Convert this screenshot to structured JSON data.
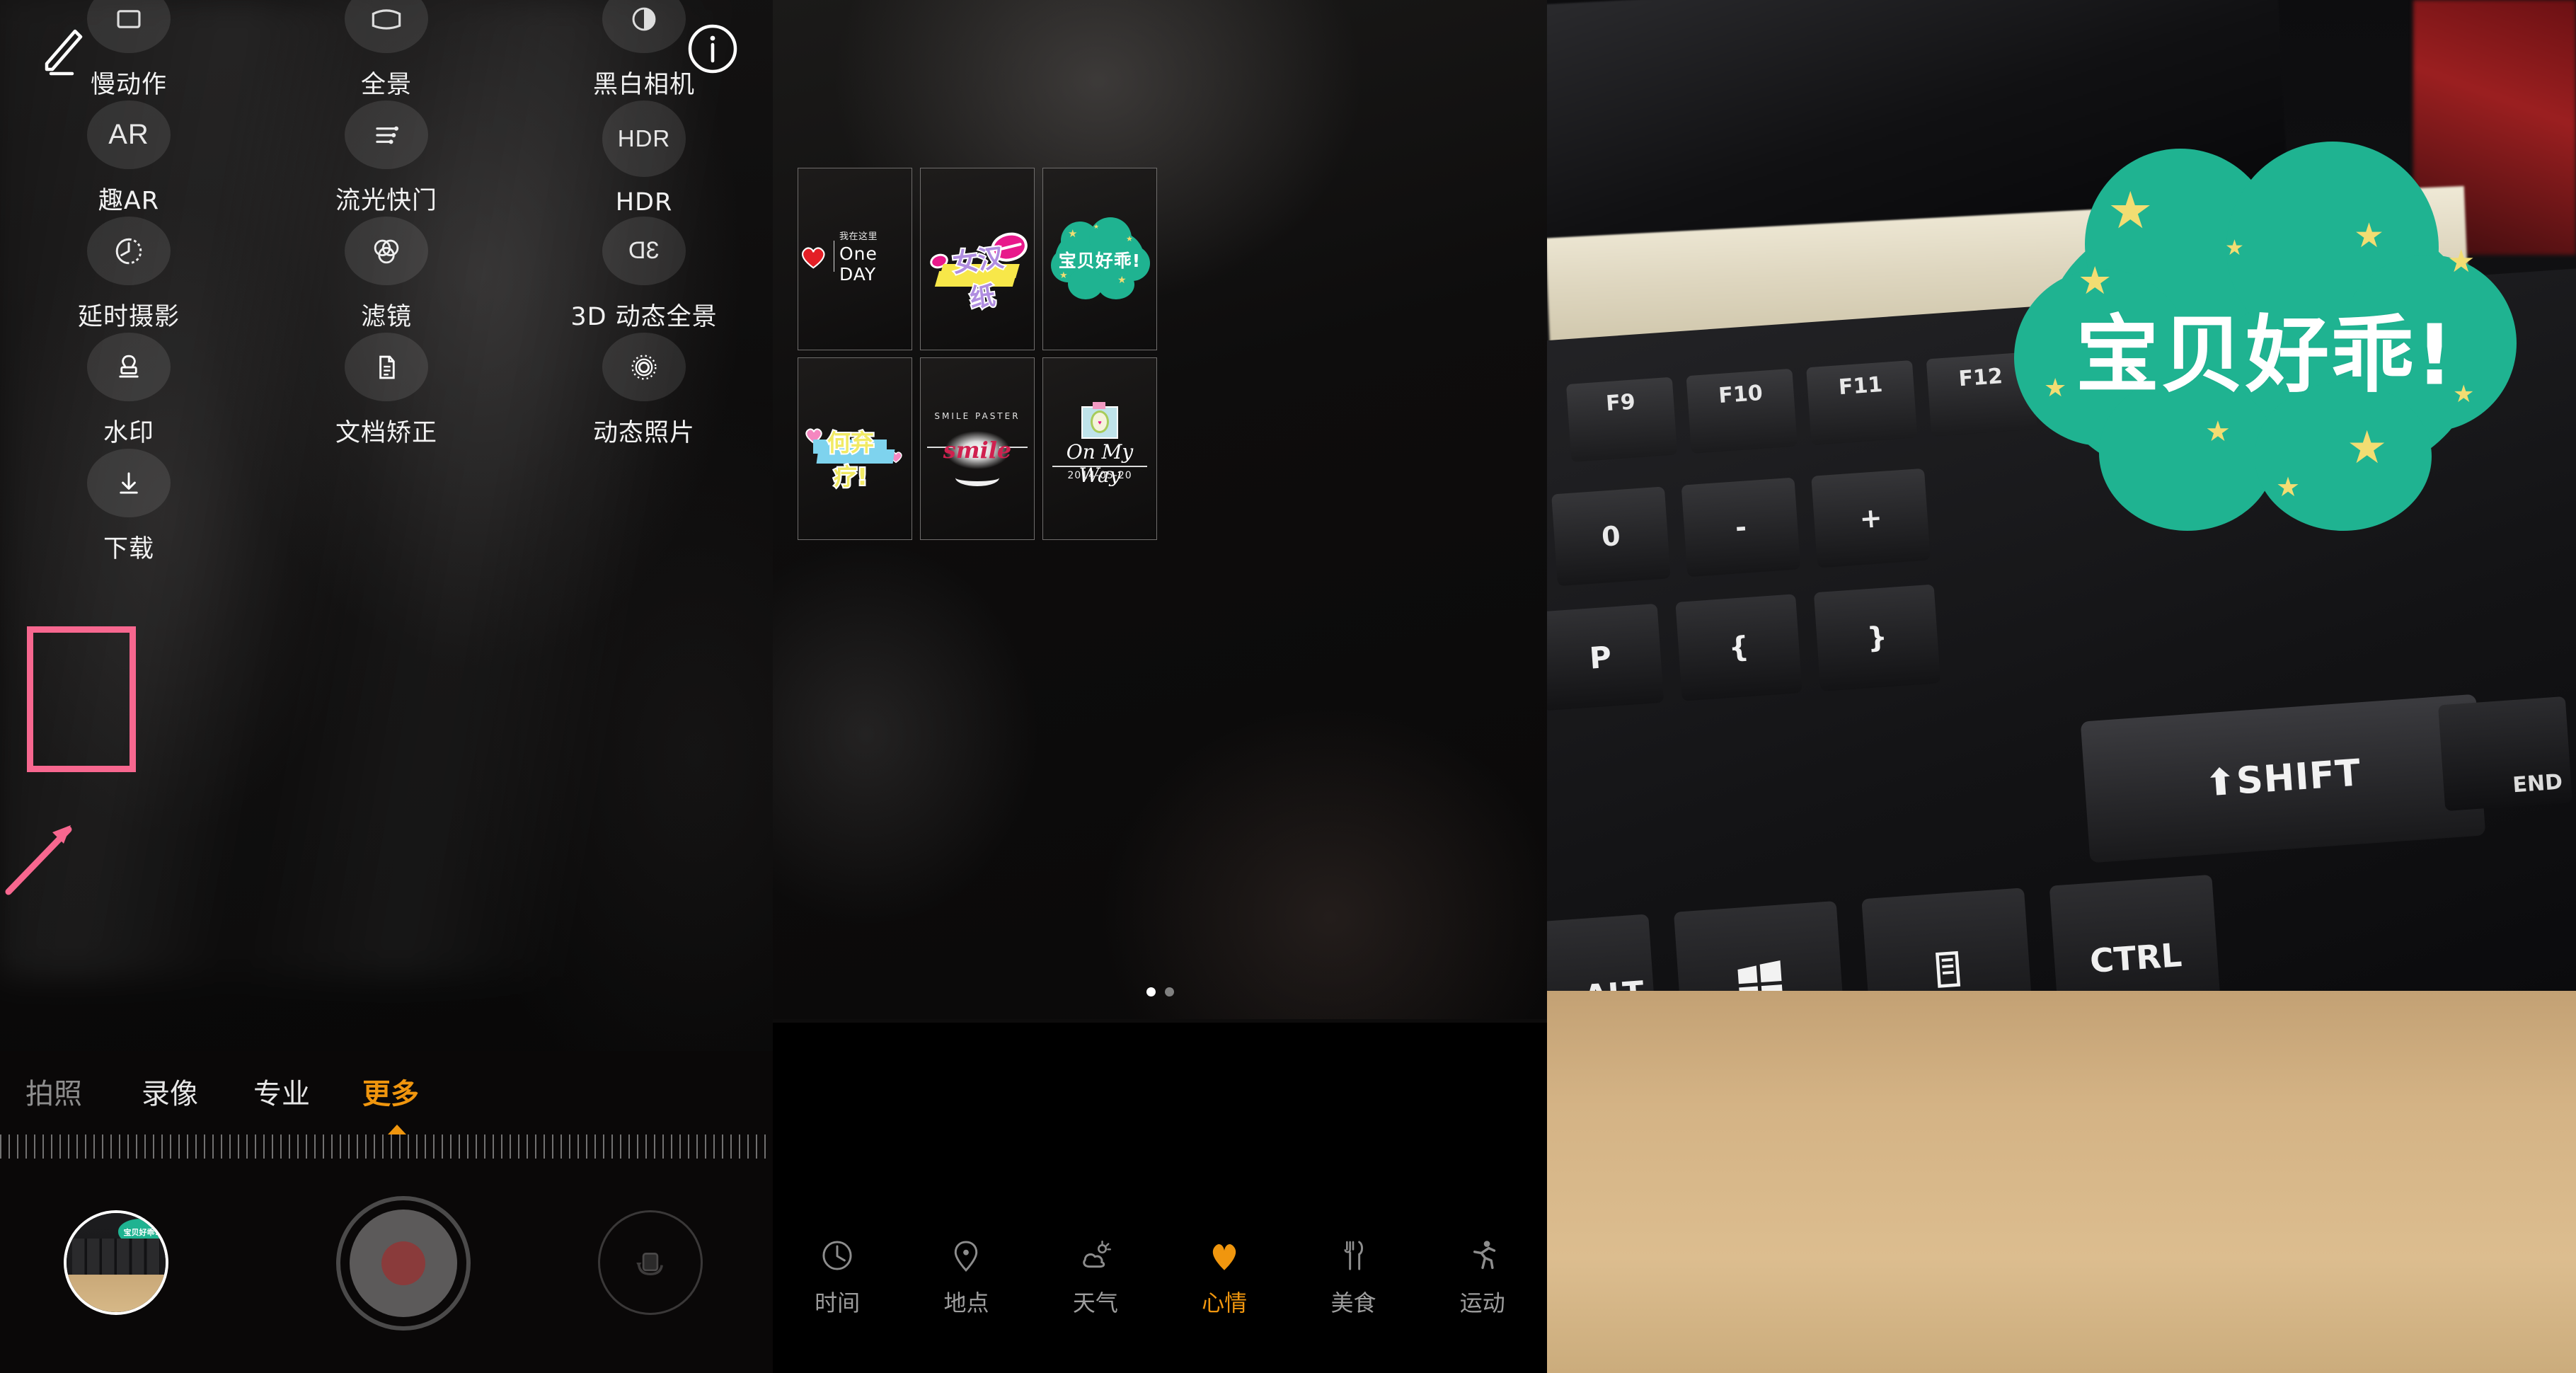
{
  "panel_camera": {
    "top_icons": {
      "edit": "pencil-icon",
      "info": "info-icon"
    },
    "modes": [
      {
        "label": "慢动作",
        "icon": "slow-motion-icon"
      },
      {
        "label": "全景",
        "icon": "panorama-icon"
      },
      {
        "label": "黑白相机",
        "icon": "monochrome-camera-icon"
      },
      {
        "label": "趣AR",
        "icon": "ar-icon",
        "glyph": "AR"
      },
      {
        "label": "流光快门",
        "icon": "light-painting-icon"
      },
      {
        "label": "HDR",
        "icon": "hdr-icon",
        "glyph": "HDR"
      },
      {
        "label": "延时摄影",
        "icon": "time-lapse-icon"
      },
      {
        "label": "滤镜",
        "icon": "filter-icon"
      },
      {
        "label": "3D 动态全景",
        "icon": "3d-panorama-icon",
        "glyph": "3D"
      },
      {
        "label": "水印",
        "icon": "watermark-stamp-icon",
        "highlighted": true
      },
      {
        "label": "文档矫正",
        "icon": "document-correction-icon"
      },
      {
        "label": "动态照片",
        "icon": "motion-photo-icon"
      },
      {
        "label": "下载",
        "icon": "download-icon"
      }
    ],
    "tabs": [
      {
        "label": "拍照",
        "state": "inactive"
      },
      {
        "label": "录像",
        "state": "dim"
      },
      {
        "label": "专业",
        "state": "dim"
      },
      {
        "label": "更多",
        "state": "active"
      }
    ],
    "controls": {
      "thumbnail": "gallery-thumbnail",
      "shutter": "shutter-button",
      "switch_camera": "switch-camera-button"
    },
    "highlight_color": "#f7678f",
    "accent_color": "#f0960e"
  },
  "panel_watermark": {
    "stickers": [
      {
        "id": "one-day",
        "line1": "我在这里",
        "line2": "One DAY",
        "kind": "heart-oneday"
      },
      {
        "id": "nv-han-zhi",
        "text": "女汉纸",
        "kind": "lips-banner"
      },
      {
        "id": "baobei-haoguai",
        "text": "宝贝好乖!",
        "kind": "cloud-green"
      },
      {
        "id": "he-qi-liao",
        "text": "何弃疗!",
        "kind": "blue-ribbon"
      },
      {
        "id": "smile",
        "top_text": "SMILE PASTER",
        "text": "smile",
        "kind": "smile-glow"
      },
      {
        "id": "on-my-way",
        "text": "On My Way",
        "date": "2014-05-20",
        "kind": "handwriting-date"
      }
    ],
    "pager": {
      "count": 2,
      "active_index": 0
    },
    "categories": [
      {
        "label": "时间",
        "icon": "clock-icon",
        "active": false
      },
      {
        "label": "地点",
        "icon": "location-pin-icon",
        "active": false
      },
      {
        "label": "天气",
        "icon": "weather-cloud-sun-icon",
        "active": false
      },
      {
        "label": "心情",
        "icon": "heart-icon",
        "active": true
      },
      {
        "label": "美食",
        "icon": "fork-knife-icon",
        "active": false
      },
      {
        "label": "运动",
        "icon": "running-person-icon",
        "active": false
      }
    ],
    "accent_color": "#f0960e"
  },
  "panel_photo": {
    "applied_sticker": {
      "text": "宝贝好乖!",
      "bubble_color": "#1fb391",
      "star_color": "#f2dd72"
    },
    "keyboard_keys": {
      "fn_row": [
        "F9",
        "F10",
        "F11",
        "F12"
      ],
      "num_row": [
        "0",
        "-",
        "+"
      ],
      "letter_row": [
        "P",
        "{",
        "}"
      ],
      "mod_row": [
        "SHIFT",
        "CTRL",
        "ALT",
        "END"
      ]
    }
  }
}
